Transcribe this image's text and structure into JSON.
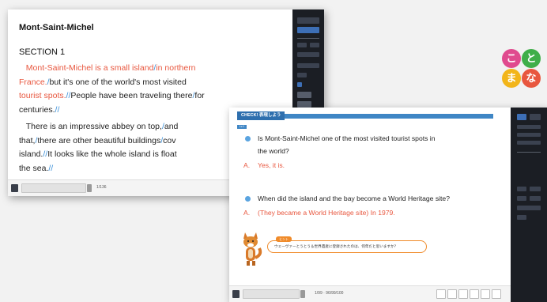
{
  "window1": {
    "title": "Mont-Saint-Michel",
    "section": "SECTION 1",
    "para1": {
      "line1": {
        "red1": "Mont-Saint-Michel is a small island",
        "sep": "/",
        "red2": "in northern"
      },
      "line2": {
        "red": "France.",
        "sep": "/",
        "text": "but it's one of the world's most visited"
      },
      "line3": {
        "red": "tourist spots.",
        "sep": "//",
        "text": "People have been traveling there",
        "sep2": "/",
        "text2": "for"
      },
      "line4": {
        "text": "centuries.",
        "sep": "//"
      }
    },
    "para2": {
      "line1": {
        "text": "There is an impressive abbey on top,",
        "sep": "/",
        "text2": "and"
      },
      "line2": {
        "text": "that,",
        "sep": "/",
        "text2": "there are other beautiful buildings",
        "sep2": "/",
        "text3": "cov"
      },
      "line3": {
        "text": "island.",
        "sep": "//",
        "text2": "It looks like the whole island is float"
      },
      "line4": {
        "text": "the sea.",
        "sep": "//"
      }
    },
    "statusbar": {
      "text": "1/136"
    }
  },
  "window2": {
    "check_tab": "CHECK! 表現しよう",
    "level_label": "Lv.1",
    "q1": {
      "line1": "Is Mont-Saint-Michel one of the most visited tourist spots in",
      "line2": "the world?"
    },
    "a1": {
      "mark": "A.",
      "text": "Yes, it is."
    },
    "q2": {
      "text": "When did the island and the bay become a World Heritage site?"
    },
    "a2": {
      "mark": "A.",
      "text": "(They became a World Heritage site) In 1979."
    },
    "bubble": {
      "tag": "ヒント",
      "text": "ウェーヴァーとうとう＆世界遺産に登録されたのは、何年だと思いますか？"
    },
    "statusbar": {
      "text": "1/99 · 96/99/100"
    }
  },
  "logo": {
    "chars": [
      "こ",
      "と",
      "ま",
      "な"
    ]
  },
  "colors": {
    "logo": [
      "#e04a8e",
      "#3fae49",
      "#f2b51a",
      "#e8573f"
    ],
    "red_text": "#e8573f",
    "blue_slash": "#3a8fd8",
    "panel": "#1b1e24"
  }
}
